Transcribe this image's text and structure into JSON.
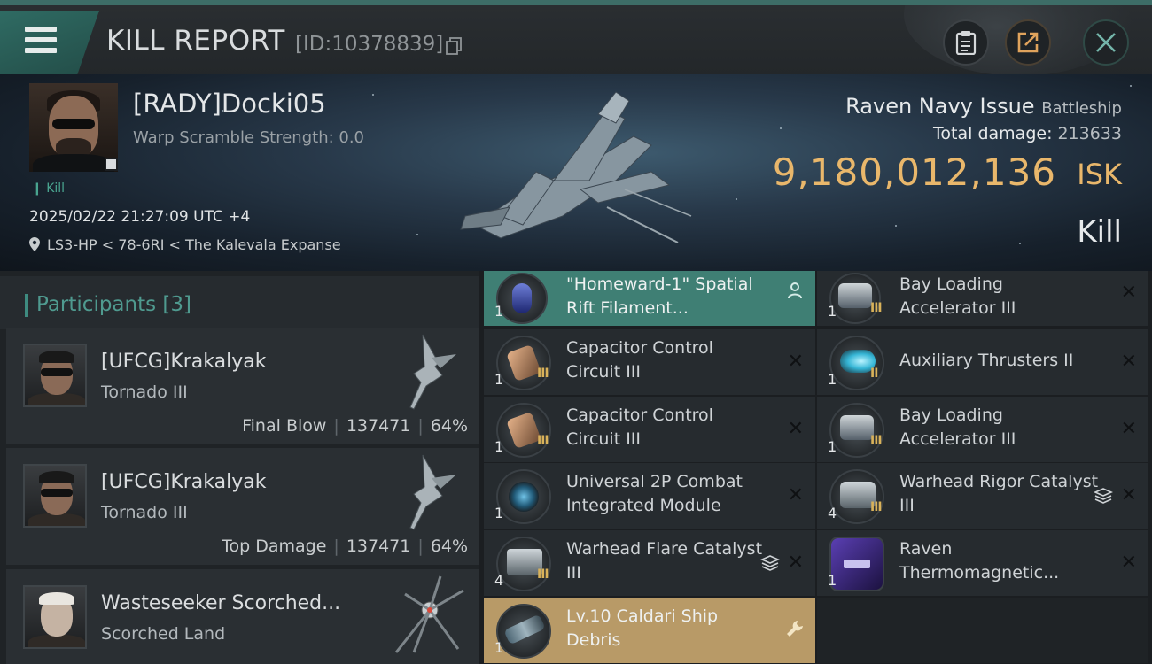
{
  "header": {
    "title": "KILL REPORT",
    "id_text": "[ID:10378839]",
    "icons": {
      "menu": "menu-icon",
      "copy": "copy-icon",
      "clipboard": "clipboard-icon",
      "share": "share-icon",
      "close": "close-icon"
    }
  },
  "victim": {
    "name": "[RADY]Docki05",
    "scramble": "Warp Scramble Strength: 0.0",
    "kill_tag": "Kill",
    "datetime": "2025/02/22 21:27:09 UTC +4",
    "location": "LS3-HP < 78-6RI < The Kalevala Expanse",
    "ship_name": "Raven Navy Issue",
    "ship_class": "Battleship",
    "total_damage_label": "Total damage:",
    "total_damage": "213633",
    "isk_value": "9,180,012,136",
    "isk_unit": "ISK",
    "result": "Kill"
  },
  "participants": {
    "label": "Participants [3]",
    "rows": [
      {
        "name": "[UFCG]Krakalyak",
        "ship": "Tornado III",
        "stat_label": "Final Blow",
        "damage": "137471",
        "percent": "64%"
      },
      {
        "name": "[UFCG]Krakalyak",
        "ship": "Tornado III",
        "stat_label": "Top Damage",
        "damage": "137471",
        "percent": "64%"
      },
      {
        "name": "Wasteseeker Scorched...",
        "ship": "Scorched Land"
      }
    ]
  },
  "items_left": [
    {
      "name": "\"Homeward-1\" Spatial Rift Filament...",
      "qty": "1",
      "state": "green"
    },
    {
      "name": "Capacitor Control Circuit III",
      "qty": "1",
      "meta": "III"
    },
    {
      "name": "Capacitor Control Circuit III",
      "qty": "1",
      "meta": "III"
    },
    {
      "name": "Universal 2P Combat Integrated Module",
      "qty": "1"
    },
    {
      "name": "Warhead Flare Catalyst III",
      "qty": "4",
      "meta": "III"
    },
    {
      "name": "Lv.10 Caldari Ship Debris",
      "qty": "1",
      "state": "gold"
    }
  ],
  "items_right": [
    {
      "name": "Bay Loading Accelerator III",
      "qty": "1",
      "meta": "III"
    },
    {
      "name": "Auxiliary Thrusters II",
      "qty": "1",
      "meta": "II"
    },
    {
      "name": "Bay Loading Accelerator III",
      "qty": "1",
      "meta": "III"
    },
    {
      "name": "Warhead Rigor Catalyst III",
      "qty": "4",
      "meta": "III"
    },
    {
      "name": "Raven Thermomagnetic...",
      "qty": "1"
    }
  ],
  "colors": {
    "accent_teal": "#3f7f74",
    "isk_gold": "#e9b76b",
    "salvage_gold": "#b89a67",
    "meta_gold": "#d9b25a"
  }
}
